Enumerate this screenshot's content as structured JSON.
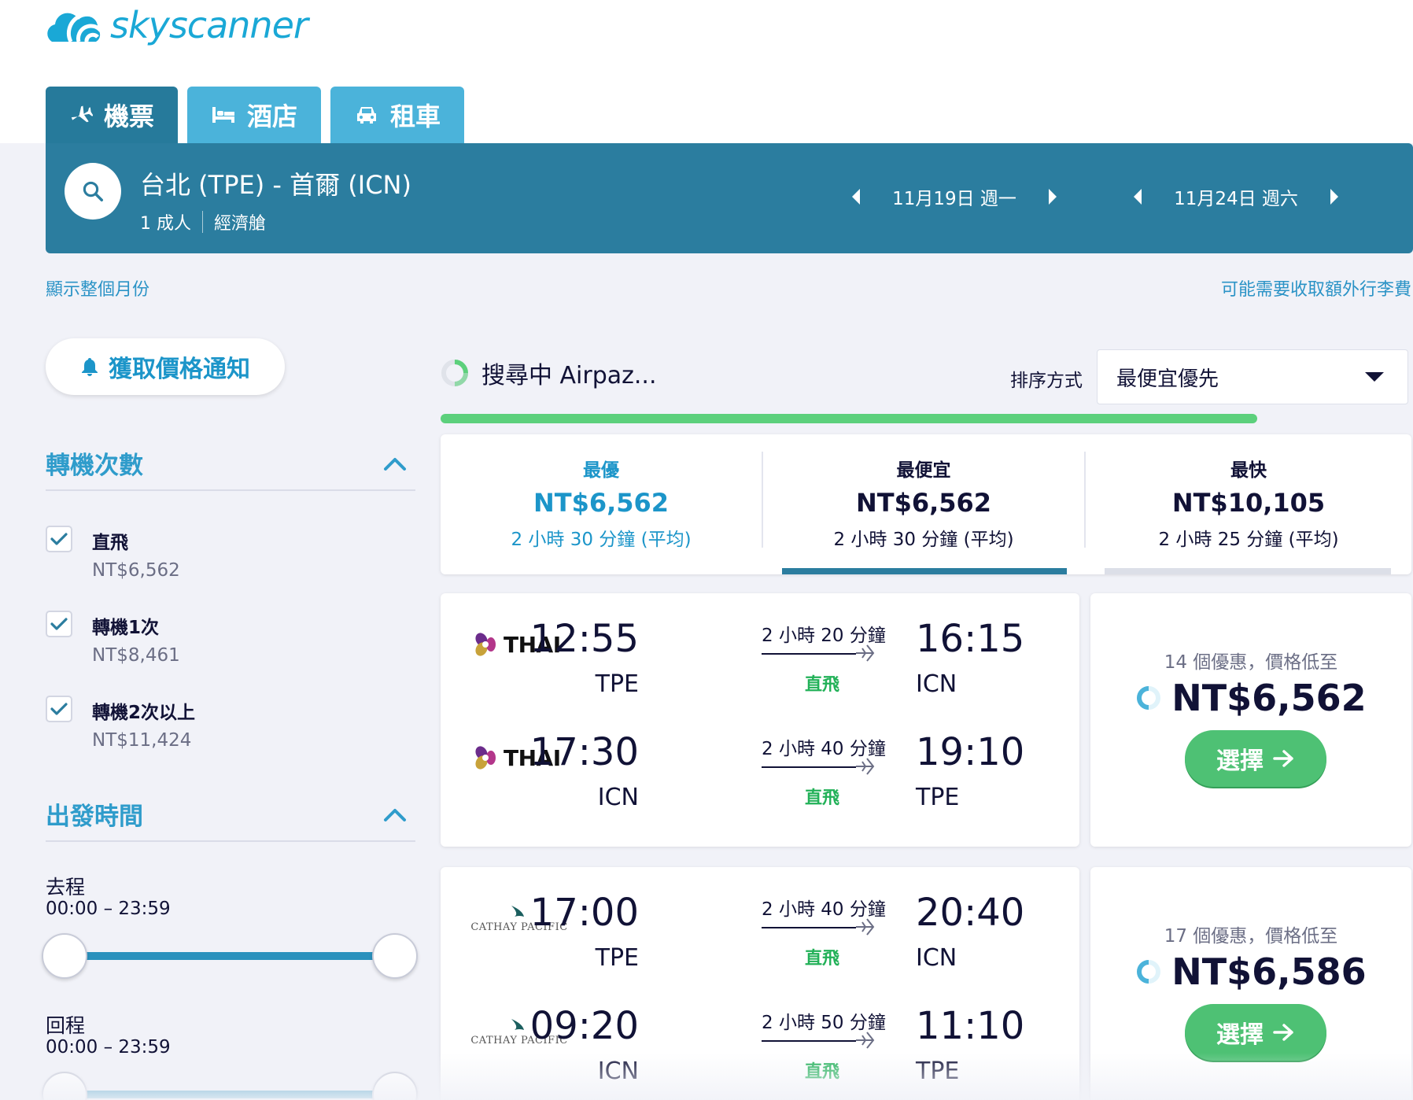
{
  "brand": {
    "logo_text": "skyscanner"
  },
  "tabs": [
    {
      "label": "機票",
      "icon": "plane-icon",
      "active": true
    },
    {
      "label": "酒店",
      "icon": "bed-icon",
      "active": false
    },
    {
      "label": "租車",
      "icon": "car-icon",
      "active": false
    }
  ],
  "search": {
    "route": "台北 (TPE) - 首爾 (ICN)",
    "travellers": "1 成人",
    "cabin": "經濟艙",
    "depart_date": "11月19日 週一",
    "return_date": "11月24日 週六"
  },
  "links": {
    "month": "顯示整個月份",
    "baggage": "可能需要收取額外行李費"
  },
  "alert_button": "獲取價格通知",
  "filters": {
    "stops": {
      "title": "轉機次數",
      "options": [
        {
          "label": "直飛",
          "price": "NT$6,562",
          "checked": true
        },
        {
          "label": "轉機1次",
          "price": "NT$8,461",
          "checked": true
        },
        {
          "label": "轉機2次以上",
          "price": "NT$11,424",
          "checked": true
        }
      ]
    },
    "times": {
      "title": "出發時間",
      "outbound_label": "去程",
      "outbound_range": "00:00 – 23:59",
      "return_label": "回程",
      "return_range": "00:00 – 23:59"
    }
  },
  "results_header": {
    "searching_text": "搜尋中 Airpaz...",
    "sort_label": "排序方式",
    "sort_value": "最便宜優先",
    "progress": 0.88
  },
  "summary": [
    {
      "title": "最優",
      "price": "NT$6,562",
      "duration": "2 小時 30 分鐘 (平均)",
      "color": "#1c95c9"
    },
    {
      "title": "最便宜",
      "price": "NT$6,562",
      "duration": "2 小時 30 分鐘 (平均)",
      "color": "#111236"
    },
    {
      "title": "最快",
      "price": "NT$10,105",
      "duration": "2 小時 25 分鐘 (平均)",
      "color": "#111236"
    }
  ],
  "results": [
    {
      "airline": "THAI",
      "legs": [
        {
          "dep_time": "12:55",
          "dep_code": "TPE",
          "duration": "2 小時 20 分鐘",
          "stops": "直飛",
          "arr_time": "16:15",
          "arr_code": "ICN"
        },
        {
          "dep_time": "17:30",
          "dep_code": "ICN",
          "duration": "2 小時 40 分鐘",
          "stops": "直飛",
          "arr_time": "19:10",
          "arr_code": "TPE"
        }
      ],
      "deals": "14 個優惠，價格低至",
      "price": "NT$6,562",
      "select_label": "選擇"
    },
    {
      "airline": "CATHAY PACIFIC",
      "legs": [
        {
          "dep_time": "17:00",
          "dep_code": "TPE",
          "duration": "2 小時 40 分鐘",
          "stops": "直飛",
          "arr_time": "20:40",
          "arr_code": "ICN"
        },
        {
          "dep_time": "09:20",
          "dep_code": "ICN",
          "duration": "2 小時 50 分鐘",
          "stops": "直飛",
          "arr_time": "11:10",
          "arr_code": "TPE"
        }
      ],
      "deals": "17 個優惠，價格低至",
      "price": "NT$6,586",
      "select_label": "選擇"
    }
  ],
  "colors": {
    "brand_blue": "#1aa8d6",
    "header_teal": "#2b7d9f",
    "tab_active": "#267a9b",
    "tab_inactive": "#4bb3da",
    "green": "#4ec174",
    "link": "#2b93c6"
  }
}
